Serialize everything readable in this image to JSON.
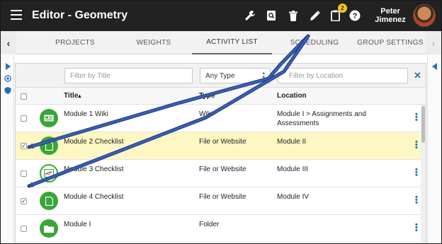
{
  "app": {
    "title": "Editor - Geometry",
    "notifications_badge": "2",
    "user_name_first": "Peter",
    "user_name_last": "Jimenez"
  },
  "toolbar": {
    "icons": [
      "wrench-icon",
      "preview-icon",
      "trash-icon",
      "pencil-icon",
      "clipboard-icon",
      "help-icon"
    ]
  },
  "tabs": [
    {
      "label": "PROJECTS"
    },
    {
      "label": "WEIGHTS"
    },
    {
      "label": "ACTIVITY LIST",
      "active": true
    },
    {
      "label": "SCHEDULING"
    },
    {
      "label": "GROUP SETTINGS"
    }
  ],
  "filters": {
    "title_placeholder": "Filter by Title",
    "type_selected": "Any Type",
    "location_placeholder": "Filter by Location"
  },
  "table": {
    "columns": {
      "title": "Title",
      "type": "Type",
      "location": "Location"
    },
    "sort_indicator": "▴",
    "rows": [
      {
        "checked": false,
        "icon": "wiki-icon",
        "icon_color": "#3aa53a",
        "title": "Module 1 Wiki",
        "type": "Wiki",
        "location_line1": "Module I > Assignments and",
        "location_line2": "Assessments"
      },
      {
        "checked": true,
        "icon": "checklist-doc-icon",
        "icon_color": "#3aa53a",
        "title": "Module 2 Checklist",
        "type": "File or Website",
        "location_line1": "Module II",
        "location_line2": ""
      },
      {
        "checked": false,
        "icon": "checklist-chart-icon",
        "icon_color": "#3aa53a",
        "title": "Module 3 Checklist",
        "type": "File or Website",
        "location_line1": "Module III",
        "location_line2": ""
      },
      {
        "checked": true,
        "icon": "checklist-doc-icon",
        "icon_color": "#3aa53a",
        "title": "Module 4 Checklist",
        "type": "File or Website",
        "location_line1": "Module IV",
        "location_line2": ""
      },
      {
        "checked": false,
        "icon": "folder-icon",
        "icon_color": "#3aa53a",
        "title": "Module I",
        "type": "Folder",
        "location_line1": "",
        "location_line2": ""
      }
    ]
  },
  "colors": {
    "appbar": "#222222",
    "selected_row": "#fdf7c3",
    "accent_blue": "#2a6fb5",
    "annotation_arrow": "#2f4f9e",
    "icon_green": "#3aa53a"
  }
}
